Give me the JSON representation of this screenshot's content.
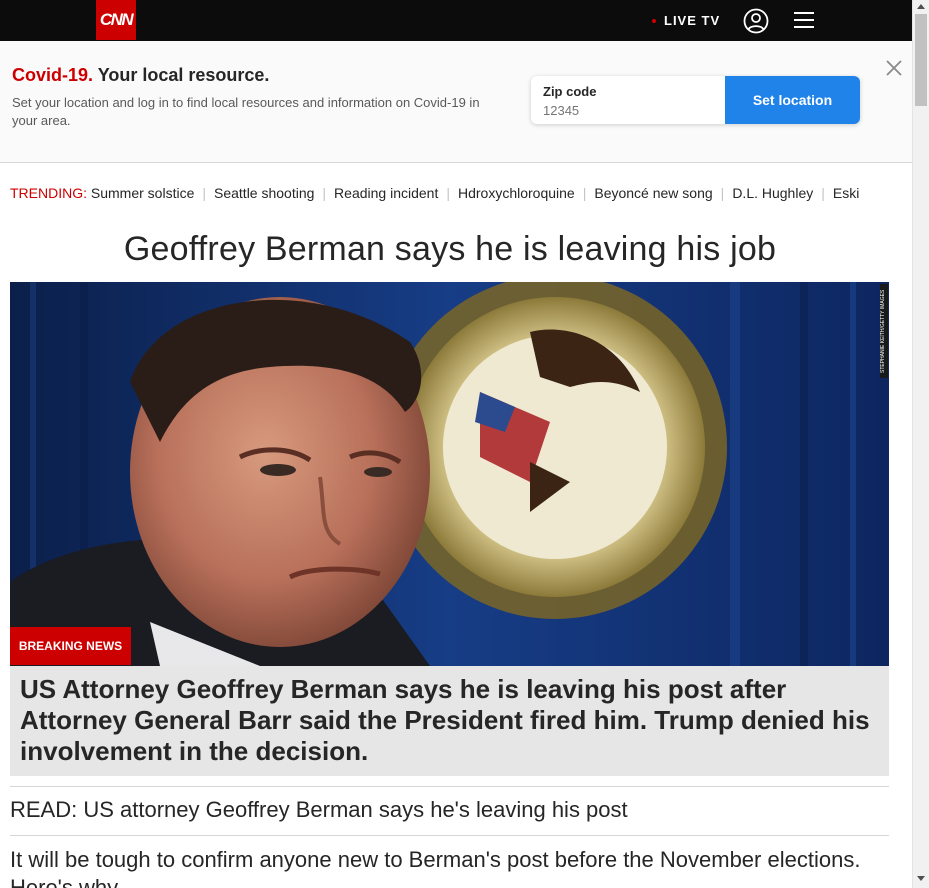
{
  "nav": {
    "logo_text": "CNN",
    "live_tv_label": "LIVE TV",
    "icons": [
      "user-icon",
      "menu-icon"
    ]
  },
  "covid_banner": {
    "title_red": "Covid-19.",
    "title_rest": " Your local resource.",
    "description": "Set your location and log in to find local resources and information on Covid-19 in your area.",
    "zip_label": "Zip code",
    "zip_placeholder": "12345",
    "button_label": "Set location",
    "close_icon": "close-icon"
  },
  "trending": {
    "label": "TRENDING:",
    "items": [
      "Summer solstice",
      "Seattle shooting",
      "Reading incident",
      "Hdroxychloroquine",
      "Beyoncé new song",
      "D.L. Hughley",
      "Eski"
    ]
  },
  "article": {
    "headline": "Geoffrey Berman says he is leaving his job",
    "breaking_label": "BREAKING NEWS",
    "breaking_text": "US Attorney Geoffrey Berman says he is leaving his post after Attorney General Barr said the President fired him. Trump denied his involvement in the decision.",
    "image_credit": "STEPHANIE KEITH/GETTY IMAGES"
  },
  "related": [
    "READ: US attorney Geoffrey Berman says he's leaving his post",
    "It will be tough to confirm anyone new to Berman's post before the November elections. Here's why"
  ],
  "colors": {
    "brand_red": "#cc0000",
    "accent_blue": "#1f83ea",
    "nav_bg": "#0c0c0c"
  }
}
